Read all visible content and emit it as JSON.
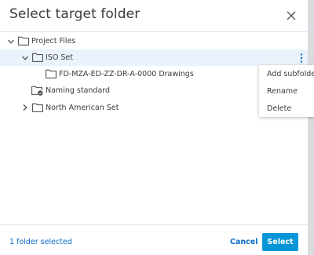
{
  "dialog": {
    "title": "Select target folder"
  },
  "tree": {
    "items": [
      {
        "label": "Project Files"
      },
      {
        "label": "ISO Set"
      },
      {
        "label": "FD-MZA-ED-ZZ-DR-A-0000 Drawings"
      },
      {
        "label": "Naming standard"
      },
      {
        "label": "North American Set"
      }
    ]
  },
  "context_menu": {
    "items": [
      "Add subfolder",
      "Rename",
      "Delete"
    ]
  },
  "footer": {
    "status": "1 folder selected",
    "cancel_label": "Cancel",
    "select_label": "Select"
  },
  "colors": {
    "accent": "#0696d7",
    "link": "#0b6bc7",
    "selected_row": "#eaf2fb"
  }
}
